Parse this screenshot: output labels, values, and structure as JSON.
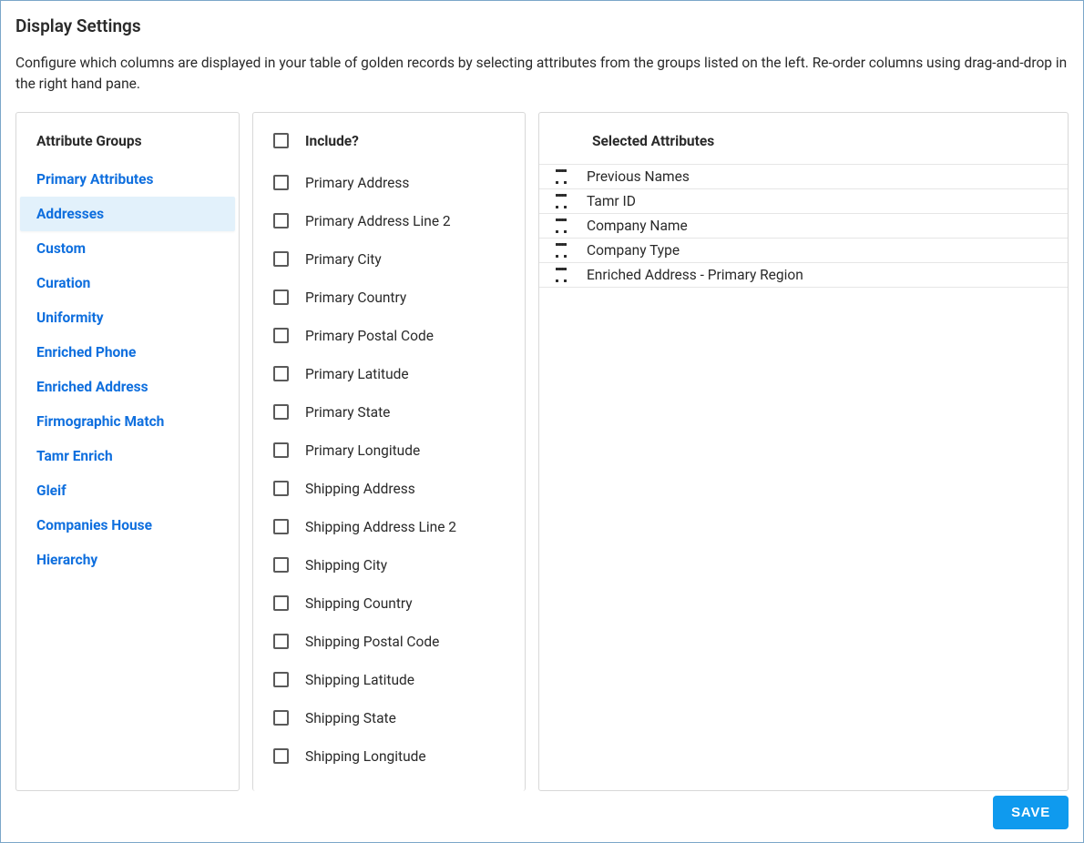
{
  "title": "Display Settings",
  "description": "Configure which columns are displayed in your table of golden records by selecting attributes from the groups listed on the left. Re-order columns using drag-and-drop in the right hand pane.",
  "groups": {
    "header": "Attribute Groups",
    "items": [
      {
        "label": "Primary Attributes",
        "active": false
      },
      {
        "label": "Addresses",
        "active": true
      },
      {
        "label": "Custom",
        "active": false
      },
      {
        "label": "Curation",
        "active": false
      },
      {
        "label": "Uniformity",
        "active": false
      },
      {
        "label": "Enriched Phone",
        "active": false
      },
      {
        "label": "Enriched Address",
        "active": false
      },
      {
        "label": "Firmographic Match",
        "active": false
      },
      {
        "label": "Tamr Enrich",
        "active": false
      },
      {
        "label": "Gleif",
        "active": false
      },
      {
        "label": "Companies House",
        "active": false
      },
      {
        "label": "Hierarchy",
        "active": false
      }
    ]
  },
  "include": {
    "header": "Include?",
    "items": [
      {
        "label": "Primary Address",
        "checked": false
      },
      {
        "label": "Primary Address Line 2",
        "checked": false
      },
      {
        "label": "Primary City",
        "checked": false
      },
      {
        "label": "Primary Country",
        "checked": false
      },
      {
        "label": "Primary Postal Code",
        "checked": false
      },
      {
        "label": "Primary Latitude",
        "checked": false
      },
      {
        "label": "Primary State",
        "checked": false
      },
      {
        "label": "Primary Longitude",
        "checked": false
      },
      {
        "label": "Shipping Address",
        "checked": false
      },
      {
        "label": "Shipping Address Line 2",
        "checked": false
      },
      {
        "label": "Shipping City",
        "checked": false
      },
      {
        "label": "Shipping Country",
        "checked": false
      },
      {
        "label": "Shipping Postal Code",
        "checked": false
      },
      {
        "label": "Shipping Latitude",
        "checked": false
      },
      {
        "label": "Shipping State",
        "checked": false
      },
      {
        "label": "Shipping Longitude",
        "checked": false
      }
    ]
  },
  "selected": {
    "header": "Selected Attributes",
    "items": [
      {
        "label": "Previous Names"
      },
      {
        "label": "Tamr ID"
      },
      {
        "label": "Company Name"
      },
      {
        "label": "Company Type"
      },
      {
        "label": "Enriched Address - Primary Region"
      }
    ]
  },
  "buttons": {
    "save": "SAVE"
  }
}
